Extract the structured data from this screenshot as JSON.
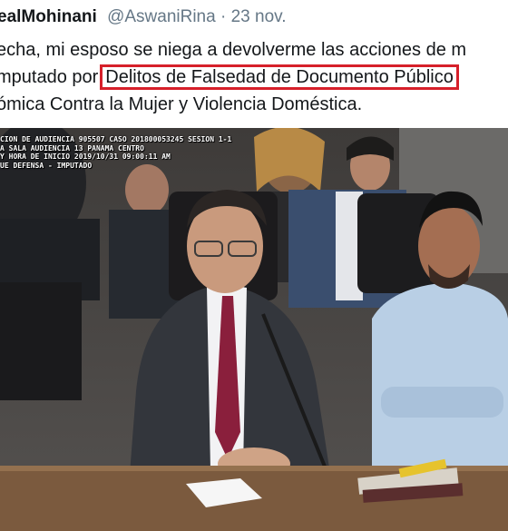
{
  "tweet": {
    "display_name": "ealMohinani",
    "handle": "@AswaniRina",
    "separator": " · ",
    "date": "23 nov.",
    "lines": [
      "echa, mi esposo se niega a devolverme las acciones de m",
      "mputado por",
      "ómica Contra la Mujer y Violencia Doméstica."
    ],
    "highlighted_text": "Delitos de Falsedad de Documento Público",
    "highlight_color": "#d6202a"
  },
  "photo": {
    "caption_lines": [
      "CION DE AUDIENCIA 905507 CASO 201800053245 SESION 1-1",
      "A SALA AUDIENCIA 13 PANAMA CENTRO",
      "Y HORA DE INICIO 2019/10/31 09:00:11 AM",
      "UE DEFENSA - IMPUTADO"
    ]
  },
  "colors": {
    "text": "#14171a",
    "secondary_text": "#657786"
  }
}
